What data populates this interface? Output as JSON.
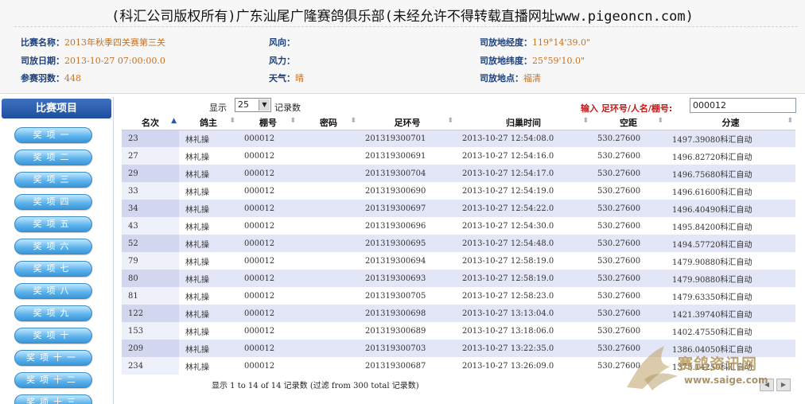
{
  "header": {
    "title": "(科汇公司版权所有)广东汕尾广隆赛鸽俱乐部(未经允许不得转载直播网址www.pigeoncn.com)",
    "race_name_label": "比赛名称：",
    "race_name": "2013年秋季四关赛第三关",
    "release_date_label": "司放日期：",
    "release_date": "2013-10-27 07:00:00.0",
    "entries_label": "参赛羽数：",
    "entries": "448",
    "wind_dir_label": "风向：",
    "wind_dir": "",
    "wind_force_label": "风力：",
    "wind_force": "",
    "weather_label": "天气：",
    "weather": "晴",
    "longitude_label": "司放地经度：",
    "longitude": "119°14'39.0\"",
    "latitude_label": "司放地纬度：",
    "latitude": "25°59'10.0\"",
    "location_label": "司放地点：",
    "location": "福清"
  },
  "sidebar": {
    "title": "比赛项目",
    "items": [
      "奖项一",
      "奖项二",
      "奖项三",
      "奖项四",
      "奖项五",
      "奖项六",
      "奖项七",
      "奖项八",
      "奖项九",
      "奖项十",
      "奖项十一",
      "奖项十二",
      "奖项十三"
    ]
  },
  "controls": {
    "show_label": "显示",
    "page_size": "25",
    "records_label": "记录数",
    "search_label": "输入 足环号/人名/棚号:",
    "search_value": "000012"
  },
  "table": {
    "columns": [
      "名次",
      "鸽主",
      "棚号",
      "密码",
      "足环号",
      "归巢时间",
      "空距",
      "分速"
    ],
    "rows": [
      [
        "23",
        "林礼操",
        "000012",
        "",
        "201319300701",
        "2013-10-27 12:54:08.0",
        "530.27600",
        "1497.39080科汇自动"
      ],
      [
        "27",
        "林礼操",
        "000012",
        "",
        "201319300691",
        "2013-10-27 12:54:16.0",
        "530.27600",
        "1496.82720科汇自动"
      ],
      [
        "29",
        "林礼操",
        "000012",
        "",
        "201319300704",
        "2013-10-27 12:54:17.0",
        "530.27600",
        "1496.75680科汇自动"
      ],
      [
        "33",
        "林礼操",
        "000012",
        "",
        "201319300690",
        "2013-10-27 12:54:19.0",
        "530.27600",
        "1496.61600科汇自动"
      ],
      [
        "34",
        "林礼操",
        "000012",
        "",
        "201319300697",
        "2013-10-27 12:54:22.0",
        "530.27600",
        "1496.40490科汇自动"
      ],
      [
        "43",
        "林礼操",
        "000012",
        "",
        "201319300696",
        "2013-10-27 12:54:30.0",
        "530.27600",
        "1495.84200科汇自动"
      ],
      [
        "52",
        "林礼操",
        "000012",
        "",
        "201319300695",
        "2013-10-27 12:54:48.0",
        "530.27600",
        "1494.57720科汇自动"
      ],
      [
        "79",
        "林礼操",
        "000012",
        "",
        "201319300694",
        "2013-10-27 12:58:19.0",
        "530.27600",
        "1479.90880科汇自动"
      ],
      [
        "80",
        "林礼操",
        "000012",
        "",
        "201319300693",
        "2013-10-27 12:58:19.0",
        "530.27600",
        "1479.90880科汇自动"
      ],
      [
        "81",
        "林礼操",
        "000012",
        "",
        "201319300705",
        "2013-10-27 12:58:23.0",
        "530.27600",
        "1479.63350科汇自动"
      ],
      [
        "122",
        "林礼操",
        "000012",
        "",
        "201319300698",
        "2013-10-27 13:13:04.0",
        "530.27600",
        "1421.39740科汇自动"
      ],
      [
        "153",
        "林礼操",
        "000012",
        "",
        "201319300689",
        "2013-10-27 13:18:06.0",
        "530.27600",
        "1402.47550科汇自动"
      ],
      [
        "209",
        "林礼操",
        "000012",
        "",
        "201319300703",
        "2013-10-27 13:22:35.0",
        "530.27600",
        "1386.04050科汇自动"
      ],
      [
        "234",
        "林礼操",
        "000012",
        "",
        "201319300687",
        "2013-10-27 13:26:09.0",
        "530.27600",
        "1375.14250科汇自动"
      ]
    ]
  },
  "footer": {
    "info": "显示 1 to 14 of 14 记录数 (过滤 from 300 total 记录数)"
  },
  "watermark": {
    "text": "赛鸽资讯网",
    "url": "www.saige.com"
  },
  "icons": {
    "sort_asc": "sort-asc-icon",
    "sort_both": "sort-both-icon",
    "dropdown": "chevron-down-icon",
    "prev": "prev-page-icon",
    "next": "next-page-icon"
  }
}
